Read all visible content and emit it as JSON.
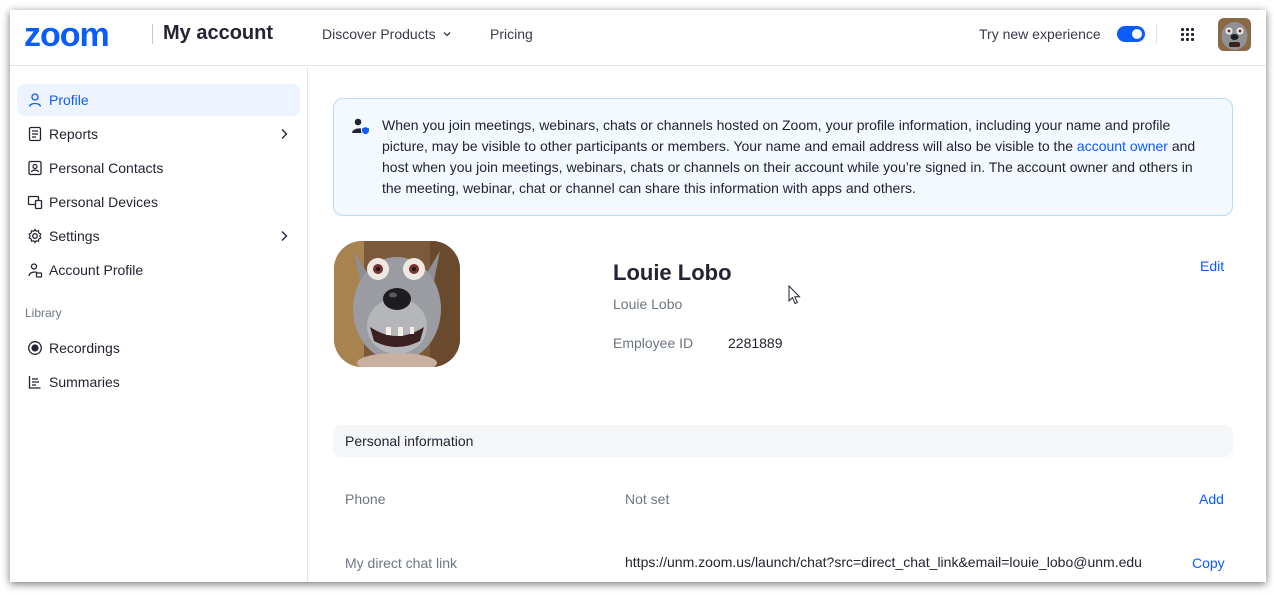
{
  "header": {
    "logo": "zoom",
    "title": "My account",
    "nav": {
      "discover": "Discover Products",
      "pricing": "Pricing"
    },
    "try_new": "Try new experience",
    "try_new_enabled": true,
    "brand_color": "#0b5cff"
  },
  "sidebar": {
    "items": [
      {
        "label": "Profile",
        "icon": "person-icon",
        "active": true
      },
      {
        "label": "Reports",
        "icon": "report-icon",
        "has_arrow": true
      },
      {
        "label": "Personal Contacts",
        "icon": "contacts-icon"
      },
      {
        "label": "Personal Devices",
        "icon": "devices-icon"
      },
      {
        "label": "Settings",
        "icon": "gear-icon",
        "has_arrow": true
      },
      {
        "label": "Account Profile",
        "icon": "account-profile-icon"
      }
    ],
    "section_label": "Library",
    "library_items": [
      {
        "label": "Recordings",
        "icon": "record-icon"
      },
      {
        "label": "Summaries",
        "icon": "summaries-icon"
      }
    ]
  },
  "notice": {
    "text_before_link": "When you join meetings, webinars, chats or channels hosted on Zoom, your profile information, including your name and profile picture, may be visible to other participants or members. Your name and email address will also be visible to the ",
    "link": "account owner",
    "text_after_link": " and host when you join meetings, webinars, chats or channels on their account while you’re signed in. The account owner and others in the meeting, webinar, chat or channel can share this information with apps and others."
  },
  "profile": {
    "name": "Louie Lobo",
    "display_name": "Louie Lobo",
    "employee_id_label": "Employee ID",
    "employee_id": "2281889",
    "edit": "Edit"
  },
  "personal_info": {
    "title": "Personal information",
    "rows": [
      {
        "label": "Phone",
        "value": "Not set",
        "action": "Add"
      },
      {
        "label": "My direct chat link",
        "value": "https://unm.zoom.us/launch/chat?src=direct_chat_link&email=louie_lobo@unm.edu",
        "action": "Copy"
      }
    ]
  }
}
